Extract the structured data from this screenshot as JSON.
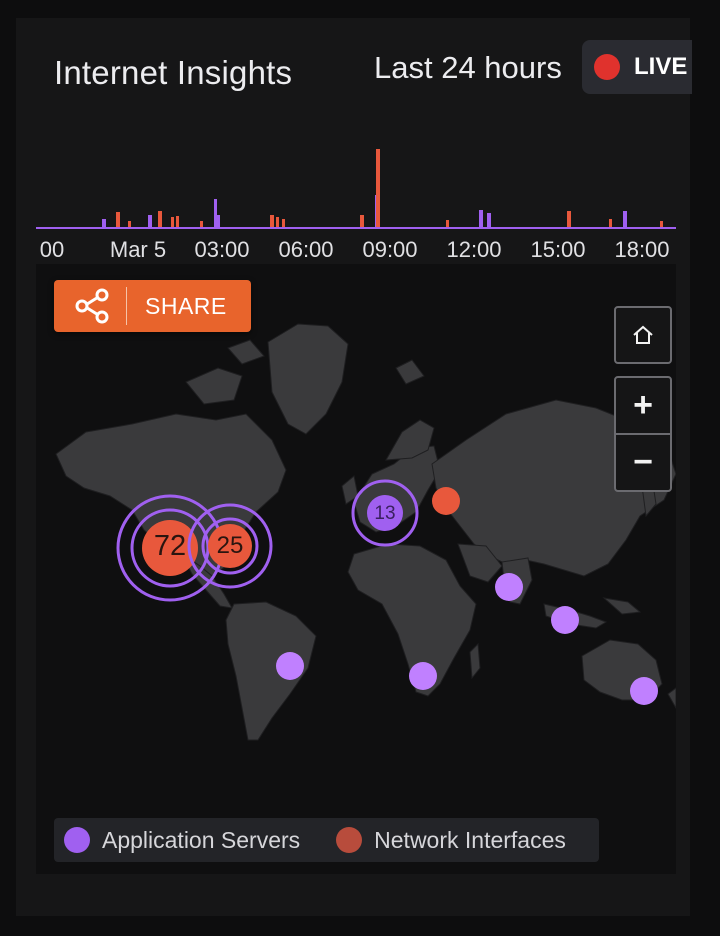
{
  "header": {
    "title": "Internet Insights",
    "range_label": "Last 24 hours",
    "live_label": "LIVE"
  },
  "colors": {
    "app_servers": "#a060f0",
    "network_interfaces": "#e8583c",
    "accent_button": "#e8642c",
    "live": "#e0322d"
  },
  "timeline": {
    "tick_labels": [
      "00",
      "Mar 5",
      "03:00",
      "06:00",
      "09:00",
      "12:00",
      "15:00",
      "18:00"
    ]
  },
  "map": {
    "share_label": "SHARE",
    "share_icon": "share-icon",
    "home_icon": "home-icon",
    "zoom_in_label": "+",
    "zoom_out_label": "−",
    "clusters": [
      {
        "count": "72",
        "type": "network_interfaces",
        "region": "north-america-west"
      },
      {
        "count": "25",
        "type": "network_interfaces",
        "region": "north-america-east"
      },
      {
        "count": "13",
        "type": "app_servers",
        "region": "europe"
      }
    ],
    "markers": [
      {
        "type": "network_interfaces",
        "region": "eastern-europe"
      },
      {
        "type": "app_servers",
        "region": "south-america"
      },
      {
        "type": "app_servers",
        "region": "south-africa"
      },
      {
        "type": "app_servers",
        "region": "india"
      },
      {
        "type": "app_servers",
        "region": "southeast-asia"
      },
      {
        "type": "app_servers",
        "region": "australia"
      }
    ]
  },
  "legend": {
    "items": [
      {
        "label": "Application Servers",
        "color": "#a060f0"
      },
      {
        "label": "Network Interfaces",
        "color": "#b84c3c"
      }
    ]
  }
}
